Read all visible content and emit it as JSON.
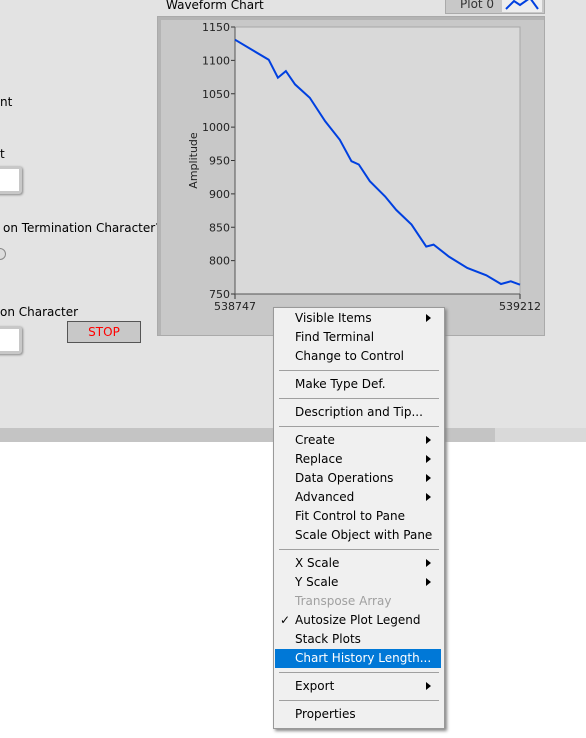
{
  "panel": {
    "label_fragment_1": "nt",
    "label_fragment_2": "t",
    "termination_question": "on Termination Character?",
    "termination_char_label": "on Character",
    "stop_label": "STOP"
  },
  "chart": {
    "title": "Waveform Chart",
    "legend_label": "Plot 0",
    "line_color": "#0040e0"
  },
  "chart_data": {
    "type": "line",
    "ylabel": "Amplitude",
    "xlabel": "",
    "ylim": [
      750,
      1150
    ],
    "xlim": [
      538747,
      539212
    ],
    "yticks": [
      "1150",
      "1100",
      "1050",
      "1000",
      "950",
      "900",
      "850",
      "800",
      "750"
    ],
    "xticks": [
      "538747",
      "539212"
    ],
    "series": [
      {
        "x": [
          538747,
          538778,
          538802,
          538817,
          538830,
          538845,
          538869,
          538894,
          538918,
          538937,
          538949,
          538967,
          538992,
          539010,
          539035,
          539059,
          539071,
          539096,
          539126,
          539157,
          539181,
          539197,
          539212
        ],
        "y": [
          1131,
          1114,
          1101,
          1074,
          1084,
          1064,
          1044,
          1009,
          981,
          949,
          944,
          919,
          896,
          876,
          854,
          821,
          824,
          806,
          789,
          778,
          765,
          769,
          764
        ]
      }
    ]
  },
  "menu": {
    "items": [
      {
        "label": "Visible Items",
        "submenu": true
      },
      {
        "label": "Find Terminal"
      },
      {
        "label": "Change to Control"
      },
      {
        "sep": true
      },
      {
        "label": "Make Type Def."
      },
      {
        "sep": true
      },
      {
        "label": "Description and Tip..."
      },
      {
        "sep": true
      },
      {
        "label": "Create",
        "submenu": true
      },
      {
        "label": "Replace",
        "submenu": true
      },
      {
        "label": "Data Operations",
        "submenu": true
      },
      {
        "label": "Advanced",
        "submenu": true
      },
      {
        "label": "Fit Control to Pane"
      },
      {
        "label": "Scale Object with Pane"
      },
      {
        "sep": true
      },
      {
        "label": "X Scale",
        "submenu": true
      },
      {
        "label": "Y Scale",
        "submenu": true
      },
      {
        "label": "Transpose Array",
        "disabled": true
      },
      {
        "label": "Autosize Plot Legend",
        "checked": true
      },
      {
        "label": "Stack Plots"
      },
      {
        "label": "Chart History Length...",
        "highlighted": true
      },
      {
        "sep": true
      },
      {
        "label": "Export",
        "submenu": true
      },
      {
        "sep": true
      },
      {
        "label": "Properties"
      }
    ]
  }
}
